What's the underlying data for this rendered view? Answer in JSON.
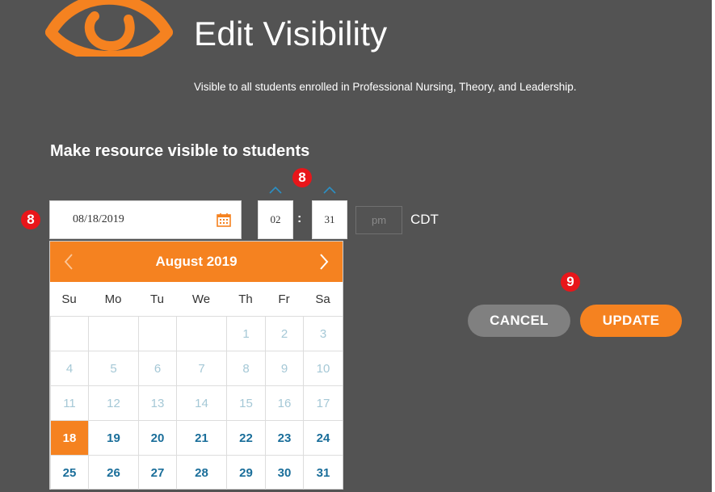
{
  "header": {
    "title": "Edit Visibility",
    "subtitle": "Visible to all students enrolled in Professional Nursing, Theory, and Leadership."
  },
  "form": {
    "heading": "Make resource visible to students",
    "date_value": "08/18/2019",
    "hour": "02",
    "minute": "31",
    "time_separator": ":",
    "ampm": "pm",
    "timezone": "CDT"
  },
  "annotations": {
    "badge_date": "8",
    "badge_time": "8",
    "badge_buttons": "9"
  },
  "calendar": {
    "month_label": "August 2019",
    "weekdays": [
      "Su",
      "Mo",
      "Tu",
      "We",
      "Th",
      "Fr",
      "Sa"
    ],
    "weeks": [
      [
        "",
        "",
        "",
        "",
        "1",
        "2",
        "3"
      ],
      [
        "4",
        "5",
        "6",
        "7",
        "8",
        "9",
        "10"
      ],
      [
        "11",
        "12",
        "13",
        "14",
        "15",
        "16",
        "17"
      ],
      [
        "18",
        "19",
        "20",
        "21",
        "22",
        "23",
        "24"
      ],
      [
        "25",
        "26",
        "27",
        "28",
        "29",
        "30",
        "31"
      ]
    ],
    "selected_day": "18"
  },
  "actions": {
    "cancel_label": "CANCEL",
    "update_label": "UPDATE"
  },
  "colors": {
    "accent": "#f58220",
    "panel_bg": "#535353",
    "badge": "#e8161a",
    "day_active": "#1a6e9a",
    "day_muted": "#a5c8d6"
  },
  "icons": {
    "logo": "eye-icon",
    "date_picker": "calendar-icon",
    "prev": "chevron-left-icon",
    "next": "chevron-right-icon",
    "spin_up": "chevron-up-icon"
  }
}
